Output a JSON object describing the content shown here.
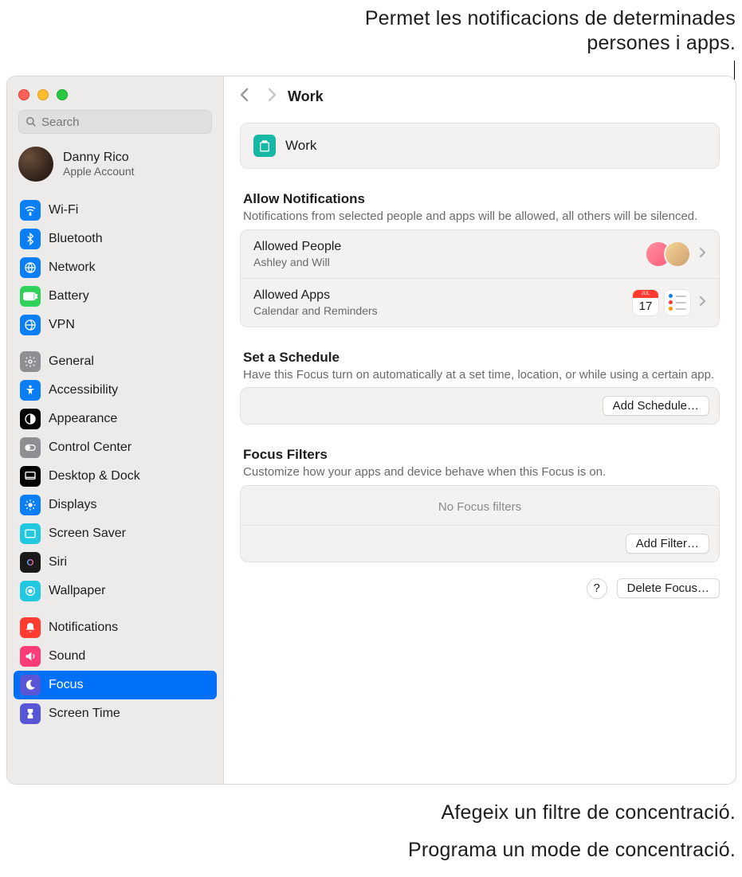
{
  "callouts": {
    "top": "Permet les notificacions de determinades persones i apps.",
    "bottom1": "Afegeix un filtre de concentració.",
    "bottom2": "Programa un mode de concentració."
  },
  "search": {
    "placeholder": "Search"
  },
  "account": {
    "name": "Danny Rico",
    "sub": "Apple Account"
  },
  "sidebar": {
    "g1": [
      {
        "label": "Wi-Fi",
        "icon": "wifi",
        "bg": "#0a7ff5"
      },
      {
        "label": "Bluetooth",
        "icon": "bt",
        "bg": "#0a7ff5"
      },
      {
        "label": "Network",
        "icon": "globe",
        "bg": "#0a7ff5"
      },
      {
        "label": "Battery",
        "icon": "batt",
        "bg": "#30d158"
      },
      {
        "label": "VPN",
        "icon": "vpn",
        "bg": "#0a7ff5"
      }
    ],
    "g2": [
      {
        "label": "General",
        "icon": "gear",
        "bg": "#8e8e93"
      },
      {
        "label": "Accessibility",
        "icon": "acc",
        "bg": "#0a7ff5"
      },
      {
        "label": "Appearance",
        "icon": "appear",
        "bg": "#000000"
      },
      {
        "label": "Control Center",
        "icon": "cc",
        "bg": "#8e8e93"
      },
      {
        "label": "Desktop & Dock",
        "icon": "dock",
        "bg": "#000000"
      },
      {
        "label": "Displays",
        "icon": "disp",
        "bg": "#0a7ff5"
      },
      {
        "label": "Screen Saver",
        "icon": "ss",
        "bg": "#22c7e0"
      },
      {
        "label": "Siri",
        "icon": "siri",
        "bg": "#1a1a1a"
      },
      {
        "label": "Wallpaper",
        "icon": "wall",
        "bg": "#22c7e0"
      }
    ],
    "g3": [
      {
        "label": "Notifications",
        "icon": "notif",
        "bg": "#ff3b30"
      },
      {
        "label": "Sound",
        "icon": "sound",
        "bg": "#ff3b78"
      },
      {
        "label": "Focus",
        "icon": "focus",
        "bg": "#5856d6",
        "selected": true
      },
      {
        "label": "Screen Time",
        "icon": "st",
        "bg": "#5856d6"
      }
    ]
  },
  "page": {
    "title": "Work",
    "focus_name": "Work",
    "allow": {
      "title": "Allow Notifications",
      "sub": "Notifications from selected people and apps will be allowed, all others will be silenced.",
      "people_title": "Allowed People",
      "people_sub": "Ashley and Will",
      "apps_title": "Allowed Apps",
      "apps_sub": "Calendar and Reminders"
    },
    "schedule": {
      "title": "Set a Schedule",
      "sub": "Have this Focus turn on automatically at a set time, location, or while using a certain app.",
      "button": "Add Schedule…"
    },
    "filters": {
      "title": "Focus Filters",
      "sub": "Customize how your apps and device behave when this Focus is on.",
      "empty": "No Focus filters",
      "button": "Add Filter…"
    },
    "delete": "Delete Focus…",
    "help": "?"
  }
}
